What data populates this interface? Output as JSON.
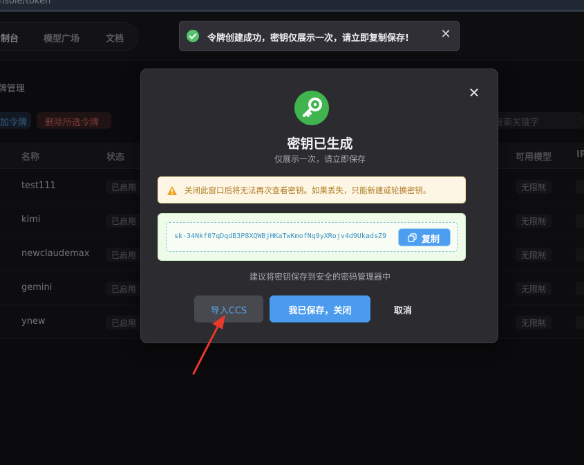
{
  "browser": {
    "url_fragment": "nsole/token"
  },
  "nav": {
    "items": [
      {
        "label": "制台",
        "active": true
      },
      {
        "label": "模型广场",
        "active": false
      },
      {
        "label": "文档",
        "active": false
      }
    ]
  },
  "page": {
    "breadcrumb": "牌管理",
    "add_label": "加令牌",
    "delete_label": "删除所选令牌",
    "search_placeholder": "搜索关键字"
  },
  "table": {
    "headers": [
      "名称",
      "状态",
      "可用模型",
      "IP"
    ],
    "rows": [
      {
        "name": "test111",
        "status": "已启用",
        "models": "无限制"
      },
      {
        "name": "kimi",
        "status": "已启用",
        "models": "无限制"
      },
      {
        "name": "newclaudemax",
        "status": "已启用",
        "models": "无限制"
      },
      {
        "name": "gemini",
        "status": "已启用",
        "models": "无限制"
      },
      {
        "name": "ynew",
        "status": "已启用",
        "models": "无限制"
      }
    ]
  },
  "toast": {
    "message": "令牌创建成功，密钥仅展示一次，请立即复制保存!",
    "close_symbol": "✕"
  },
  "modal": {
    "close_symbol": "✕",
    "title": "密钥已生成",
    "subtitle": "仅展示一次，请立即保存",
    "warning": "关闭此窗口后将无法再次查看密钥。如果丢失，只能新建或轮换密钥。",
    "key": "sk-34Nkf07qDqdB3P8XQWBjHKaTwKmofNq9yXRojv4d9UkadsZ9",
    "copy_label": "复制",
    "hint": "建议将密钥保存到安全的密码管理器中",
    "import_label": "导入CCS",
    "save_close_label": "我已保存，关闭",
    "cancel_label": "取消"
  },
  "colors": {
    "accent": "#4b9bee",
    "success": "#3fb44f",
    "danger": "#e36c6c",
    "annotation": "#e8392c"
  }
}
